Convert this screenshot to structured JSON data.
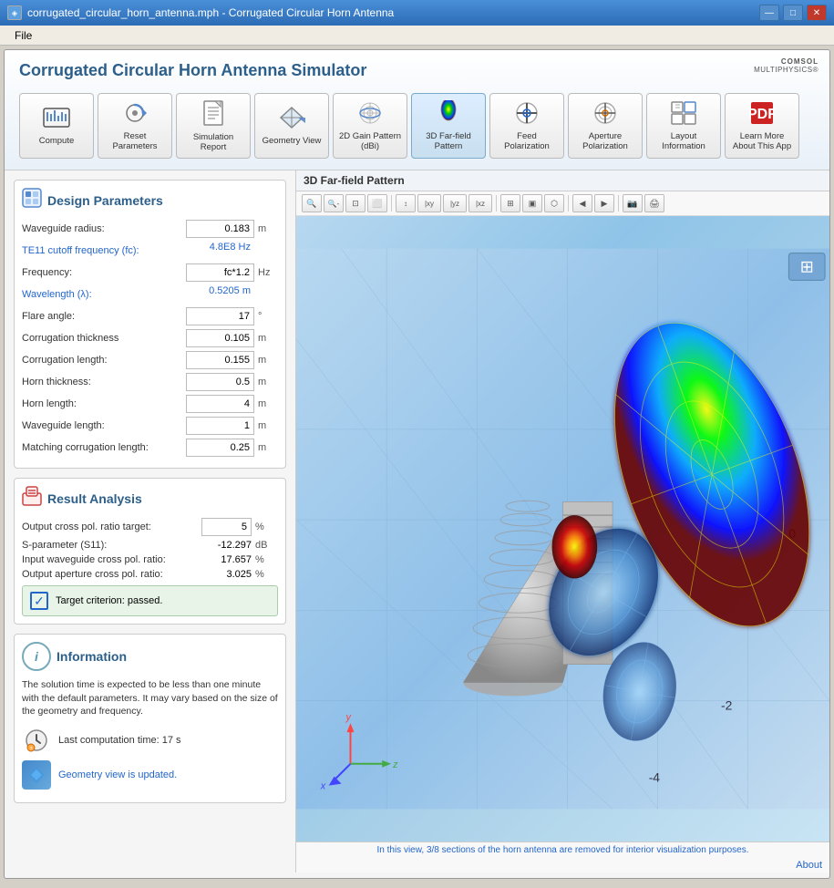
{
  "titlebar": {
    "title": "corrugated_circular_horn_antenna.mph - Corrugated Circular Horn Antenna",
    "icon": "◈"
  },
  "menubar": {
    "items": [
      "File"
    ]
  },
  "app": {
    "title": "Corrugated Circular Horn Antenna Simulator",
    "logo": "COMSOL\nMULTIPHYSICS®"
  },
  "toolbar": {
    "buttons": [
      {
        "id": "compute",
        "icon": "▦",
        "label": "Compute"
      },
      {
        "id": "reset-parameters",
        "icon": "↺",
        "label": "Reset Parameters"
      },
      {
        "id": "simulation-report",
        "icon": "≡",
        "label": "Simulation Report"
      },
      {
        "id": "geometry-view",
        "icon": "◁",
        "label": "Geometry View"
      },
      {
        "id": "2d-gain-pattern",
        "icon": "◎",
        "label": "2D Gain Pattern (dBi)"
      },
      {
        "id": "3d-farfield-pattern",
        "icon": "⬡",
        "label": "3D Far-field Pattern"
      },
      {
        "id": "feed-polarization",
        "icon": "⊕",
        "label": "Feed Polarization"
      },
      {
        "id": "aperture-polarization",
        "icon": "⊗",
        "label": "Aperture Polarization"
      },
      {
        "id": "layout-information",
        "icon": "⊞",
        "label": "Layout Information"
      },
      {
        "id": "learn-more",
        "icon": "📄",
        "label": "Learn More About This App"
      }
    ]
  },
  "design_parameters": {
    "section_title": "Design Parameters",
    "params": [
      {
        "label": "Waveguide radius:",
        "value": "0.183",
        "unit": "m",
        "is_link": false,
        "is_blue_val": false
      },
      {
        "label": "TE11 cutoff frequency (fc):",
        "value": "4.8E8 Hz",
        "unit": "",
        "is_link": true,
        "is_blue_val": true
      },
      {
        "label": "Frequency:",
        "value": "fc*1.2",
        "unit": "Hz",
        "is_link": false,
        "is_blue_val": false
      },
      {
        "label": "Wavelength (λ):",
        "value": "0.5205 m",
        "unit": "",
        "is_link": true,
        "is_blue_val": true
      },
      {
        "label": "Flare angle:",
        "value": "17",
        "unit": "°",
        "is_link": false,
        "is_blue_val": false
      },
      {
        "label": "Corrugation thickness",
        "value": "0.105",
        "unit": "m",
        "is_link": false,
        "is_blue_val": false
      },
      {
        "label": "Corrugation length:",
        "value": "0.155",
        "unit": "m",
        "is_link": false,
        "is_blue_val": false
      },
      {
        "label": "Horn thickness:",
        "value": "0.5",
        "unit": "m",
        "is_link": false,
        "is_blue_val": false
      },
      {
        "label": "Horn length:",
        "value": "4",
        "unit": "m",
        "is_link": false,
        "is_blue_val": false
      },
      {
        "label": "Waveguide length:",
        "value": "1",
        "unit": "m",
        "is_link": false,
        "is_blue_val": false
      },
      {
        "label": "Matching corrugation length:",
        "value": "0.25",
        "unit": "m",
        "is_link": false,
        "is_blue_val": false
      }
    ]
  },
  "result_analysis": {
    "section_title": "Result Analysis",
    "rows": [
      {
        "label": "Output cross pol. ratio target:",
        "value": "5",
        "unit": "%",
        "is_input": true
      },
      {
        "label": "S-parameter (S11):",
        "value": "-12.297",
        "unit": "dB",
        "is_input": false
      },
      {
        "label": "Input waveguide cross pol. ratio:",
        "value": "17.657",
        "unit": "%",
        "is_input": false
      },
      {
        "label": "Output aperture cross pol. ratio:",
        "value": "3.025",
        "unit": "%",
        "is_input": false
      }
    ],
    "target_text": "Target criterion: passed."
  },
  "information": {
    "section_title": "Information",
    "info_text": "The solution time is expected to be less than one minute with the default parameters. It may vary based on the size of the geometry and frequency.",
    "computation_time": "Last computation time: 17 s",
    "geometry_link": "Geometry view is updated."
  },
  "view": {
    "title": "3D Far-field Pattern",
    "note": "In this view, 3/8 sections of the horn antenna are removed for interior visualization purposes.",
    "about_label": "About"
  },
  "toolbar_buttons": {
    "zoom_in": "🔍",
    "zoom_out": "🔍",
    "fit": "⊞",
    "xy_label": "|xy",
    "yz_label": "|yz",
    "xz_label": "|xz",
    "perspective": "⬡"
  }
}
